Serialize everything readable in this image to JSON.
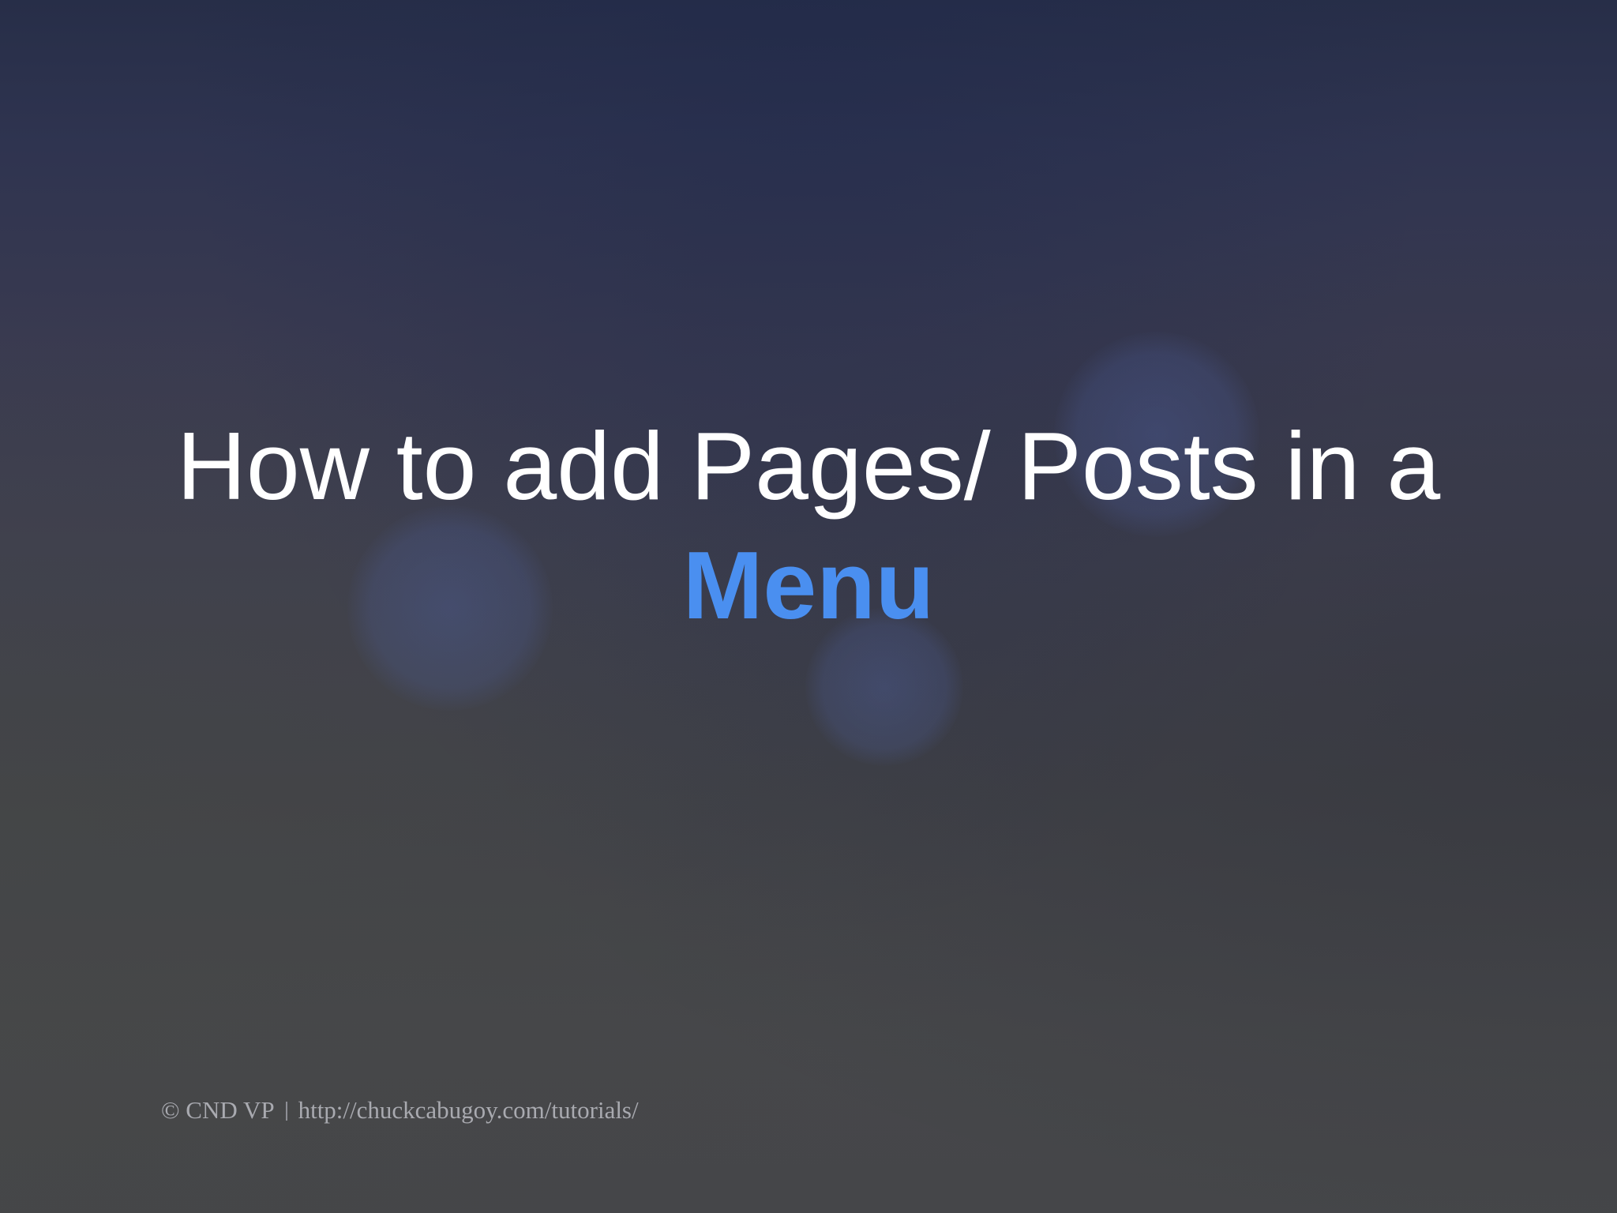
{
  "slide": {
    "title_line1": "How to add Pages/ Posts in a",
    "title_line2": "Menu",
    "accent_color": "#4a8ff0",
    "footer": {
      "copyright": "© CND VP",
      "url": "http://chuckcabugoy.com/tutorials/"
    }
  }
}
